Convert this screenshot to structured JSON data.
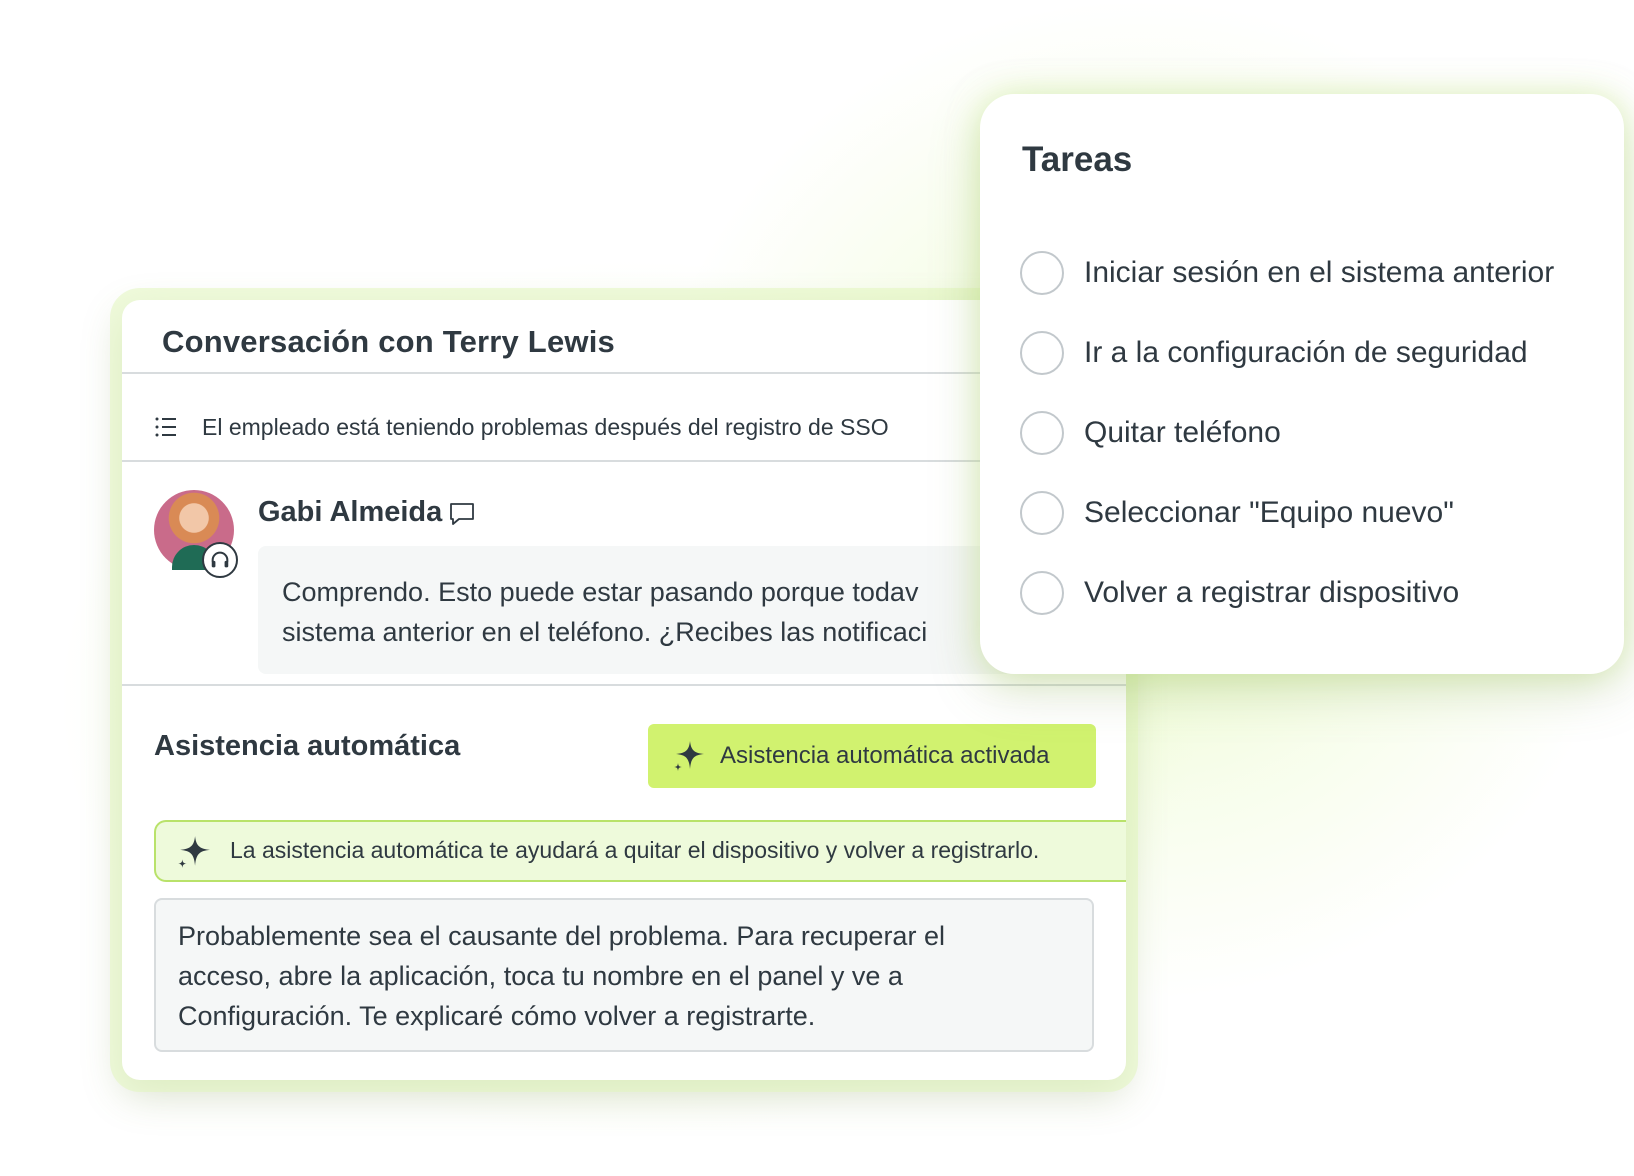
{
  "conversation": {
    "title": "Conversación con Terry Lewis",
    "summary": "El empleado está teniendo problemas después del registro de SSO",
    "message": {
      "author": "Gabi Almeida",
      "line1": "Comprendo. Esto puede estar pasando porque todav",
      "line2": "sistema anterior en el teléfono. ¿Recibes las notificaci"
    },
    "auto_assist": {
      "label": "Asistencia automática",
      "button_label": "Asistencia automática activada",
      "notice": "La asistencia automática te ayudará a quitar el dispositivo y volver a registrarlo.",
      "reply_lines": [
        "Probablemente sea el causante del problema. Para recuperar el",
        "acceso, abre la aplicación, toca tu nombre en el panel y ve a",
        "Configuración. Te explicaré cómo volver a registrarte."
      ]
    }
  },
  "tasks": {
    "title": "Tareas",
    "items": [
      {
        "label": "Iniciar sesión en el sistema anterior",
        "done": false
      },
      {
        "label": "Ir a la configuración de seguridad",
        "done": false
      },
      {
        "label": "Quitar teléfono",
        "done": false
      },
      {
        "label": "Seleccionar \"Equipo nuevo\"",
        "done": false
      },
      {
        "label": "Volver a registrar dispositivo",
        "done": false
      }
    ]
  },
  "colors": {
    "accent": "#d1f26f",
    "notice_bg": "#eefadb",
    "text": "#2f3941"
  },
  "icons": {
    "summary": "list-icon",
    "comment": "comment-icon",
    "headset": "headset-icon",
    "sparkle": "sparkle-icon"
  }
}
